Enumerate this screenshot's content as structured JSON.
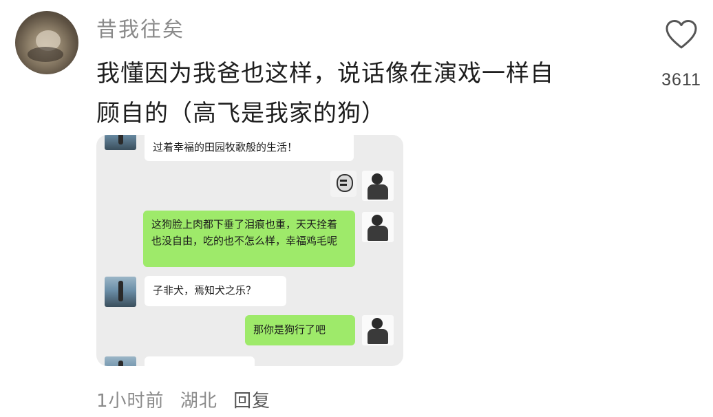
{
  "comment": {
    "username": "昔我往矣",
    "text_line1": "我懂因为我爸也这样，说话像在演戏一样自",
    "text_line2": "顾自的（高飞是我家的狗）",
    "likes": "3611",
    "time": "1小时前",
    "location": "湖北",
    "reply_label": "回复"
  },
  "chat_screenshot": {
    "messages": [
      {
        "side": "left",
        "text": "过着幸福的田园牧歌般的生活！"
      },
      {
        "side": "right",
        "type": "sticker"
      },
      {
        "side": "right",
        "text": "这狗脸上肉都下垂了泪痕也重，天天拴着也没自由，吃的也不怎么样，幸福鸡毛呢"
      },
      {
        "side": "left",
        "text": "子非犬，焉知犬之乐？"
      },
      {
        "side": "right",
        "text": "那你是狗行了吧"
      }
    ],
    "colors": {
      "left_bubble": "#ffffff",
      "right_bubble": "#9eea6a",
      "background": "#ececec"
    }
  },
  "icons": {
    "like": "heart-outline-icon"
  }
}
